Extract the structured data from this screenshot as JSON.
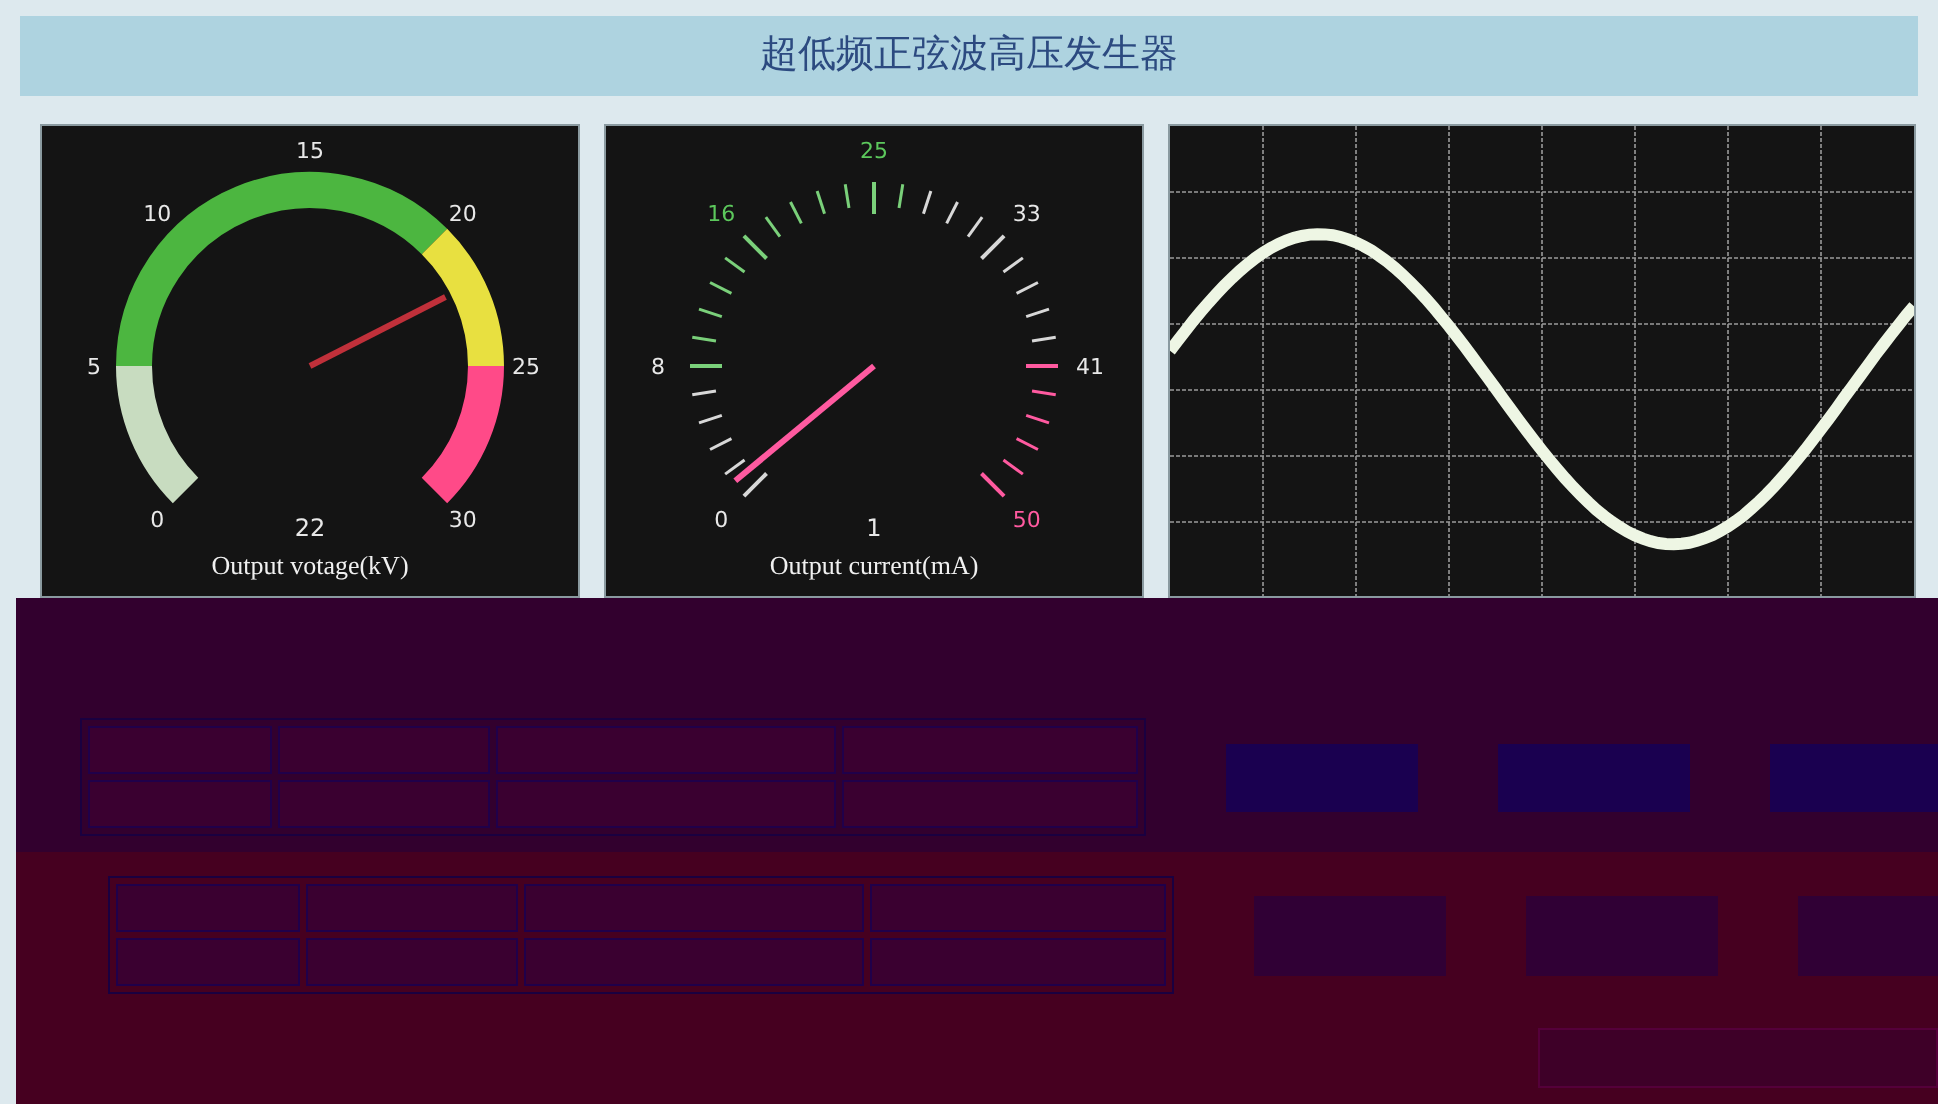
{
  "title": "超低频正弦波高压发生器",
  "gauges": [
    {
      "kind": "zoned",
      "ticks": [
        "0",
        "5",
        "10",
        "15",
        "20",
        "25",
        "30"
      ],
      "reading": "22",
      "label": "Output votage(kV)"
    },
    {
      "kind": "ticks",
      "ticks": [
        {
          "label": "0",
          "color": "#e8e8e8"
        },
        {
          "label": "8",
          "color": "#e8e8e8"
        },
        {
          "label": "16",
          "color": "#5cc85c"
        },
        {
          "label": "25",
          "color": "#5cc85c"
        },
        {
          "label": "33",
          "color": "#e8e8e8"
        },
        {
          "label": "41",
          "color": "#e8e8e8"
        },
        {
          "label": "50",
          "color": "#ff5aa0"
        }
      ],
      "reading": "1",
      "label": "Output current(mA)"
    }
  ],
  "waveform": {
    "kind": "sine"
  }
}
